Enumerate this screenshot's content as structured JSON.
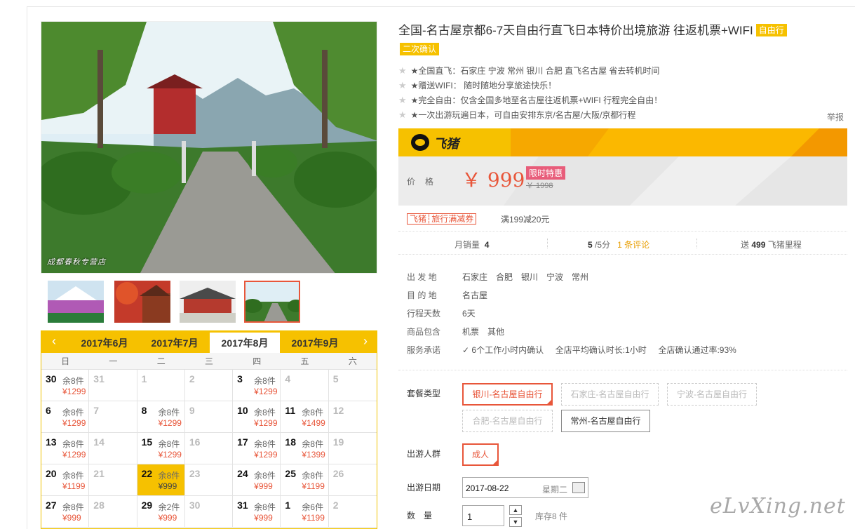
{
  "product": {
    "title": "全国-名古屋京都6-7天自由行直飞日本特价出境旅游 往返机票+WIFI",
    "tag_free": "自由行",
    "tag_confirm": "二次确认",
    "features": [
      "★全国直飞：石家庄 宁波 常州 银川 合肥 直飞名古屋 省去转机时间",
      "★赠送WIFI： 随时随地分享旅途快乐！",
      "★完全自由：仅含全国多地至名古屋往返机票+WIFI 行程完全自由！",
      "★一次出游玩遍日本，可自由安排东京/名古屋/大阪/京都行程"
    ],
    "report": "举报"
  },
  "brand": {
    "name": "飞猪",
    "accent": "#f6c100"
  },
  "price": {
    "label": "价格",
    "current": "￥ 999",
    "promo": "限时特惠",
    "original": "￥ 1998"
  },
  "coupon": {
    "badge": "飞猪┆旅行满减券",
    "text": "满199减20元"
  },
  "stats": {
    "sales_label": "月销量",
    "sales": "4",
    "rating": "5",
    "rating_max": "/5分",
    "reviews": "1 条评论",
    "points_prefix": "送",
    "points": "499",
    "points_suffix": "飞猪里程"
  },
  "info": {
    "depart_label": "出 发 地",
    "depart": "石家庄　合肥　银川　宁波　常州",
    "dest_label": "目 的 地",
    "dest": "名古屋",
    "days_label": "行程天数",
    "days": "6天",
    "includes_label": "商品包含",
    "includes": "机票　其他",
    "service_label": "服务承诺",
    "service_1": "6个工作小时内确认",
    "service_2": "全店平均确认时长:1小时",
    "service_3": "全店确认通过率:93%"
  },
  "package": {
    "label": "套餐类型",
    "options": [
      "银川-名古屋自由行",
      "石家庄-名古屋自由行",
      "宁波-名古屋自由行",
      "合肥-名古屋自由行",
      "常州-名古屋自由行"
    ]
  },
  "people": {
    "label": "出游人群",
    "option": "成人"
  },
  "date": {
    "label": "出游日期",
    "value": "2017-08-22",
    "weekday": "星期二"
  },
  "quantity": {
    "label": "数　量",
    "value": "1",
    "stock": "库存8 件"
  },
  "gallery": {
    "watermark": "成都春秋专营店"
  },
  "calendar": {
    "months": [
      "2017年6月",
      "2017年7月",
      "2017年8月",
      "2017年9月"
    ],
    "weekdays": [
      "日",
      "一",
      "二",
      "三",
      "四",
      "五",
      "六"
    ],
    "cells": [
      {
        "d": "30",
        "s": "余8件",
        "p": "¥1299"
      },
      {
        "d": "31",
        "off": true
      },
      {
        "d": "1",
        "off": true
      },
      {
        "d": "2",
        "off": true
      },
      {
        "d": "3",
        "s": "余8件",
        "p": "¥1299"
      },
      {
        "d": "4",
        "off": true
      },
      {
        "d": "5",
        "off": true
      },
      {
        "d": "6",
        "s": "余8件",
        "p": "¥1299"
      },
      {
        "d": "7",
        "off": true
      },
      {
        "d": "8",
        "s": "余8件",
        "p": "¥1299"
      },
      {
        "d": "9",
        "off": true
      },
      {
        "d": "10",
        "s": "余8件",
        "p": "¥1299"
      },
      {
        "d": "11",
        "s": "余8件",
        "p": "¥1499"
      },
      {
        "d": "12",
        "off": true
      },
      {
        "d": "13",
        "s": "余8件",
        "p": "¥1299"
      },
      {
        "d": "14",
        "off": true
      },
      {
        "d": "15",
        "s": "余8件",
        "p": "¥1299"
      },
      {
        "d": "16",
        "off": true
      },
      {
        "d": "17",
        "s": "余8件",
        "p": "¥1299"
      },
      {
        "d": "18",
        "s": "余8件",
        "p": "¥1399"
      },
      {
        "d": "19",
        "off": true
      },
      {
        "d": "20",
        "s": "余8件",
        "p": "¥1199"
      },
      {
        "d": "21",
        "off": true
      },
      {
        "d": "22",
        "s": "余8件",
        "p": "¥999",
        "hl": true
      },
      {
        "d": "23",
        "off": true
      },
      {
        "d": "24",
        "s": "余8件",
        "p": "¥999"
      },
      {
        "d": "25",
        "s": "余8件",
        "p": "¥1199"
      },
      {
        "d": "26",
        "off": true
      },
      {
        "d": "27",
        "s": "余8件",
        "p": "¥999"
      },
      {
        "d": "28",
        "off": true
      },
      {
        "d": "29",
        "s": "余2件",
        "p": "¥999"
      },
      {
        "d": "30",
        "off": true
      },
      {
        "d": "31",
        "s": "余8件",
        "p": "¥999"
      },
      {
        "d": "1",
        "s": "余6件",
        "p": "¥1199"
      },
      {
        "d": "2",
        "off": true
      }
    ]
  },
  "site_watermark": "eLvXing.net"
}
